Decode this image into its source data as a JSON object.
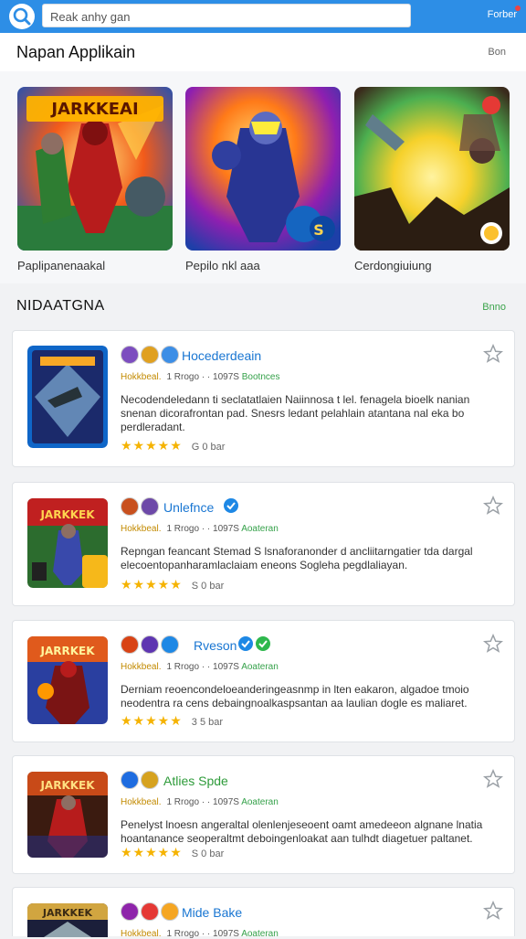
{
  "topbar": {
    "search_icon": "search-icon",
    "search_value": "Reak anhy gan",
    "right_label": "Forber"
  },
  "header": {
    "title": "Napan Applikain",
    "more": "Bon"
  },
  "featured": [
    {
      "caption": "Paplipanenaakal",
      "art_title": "JARKKEAI",
      "colors": [
        "#1a4fb8",
        "#f25b1a",
        "#2a7b3c"
      ]
    },
    {
      "caption": "Pepilo nkl aaa",
      "art_title": "",
      "colors": [
        "#5b1db0",
        "#ff7a18",
        "#1d3fa8"
      ]
    },
    {
      "caption": "Cerdongiuiung",
      "art_title": "",
      "colors": [
        "#3a2b1c",
        "#f6d12b",
        "#58c43b"
      ]
    }
  ],
  "section": {
    "title": "NIDAATGNA",
    "more": "Bnno"
  },
  "list": [
    {
      "name": "Hocederdeain",
      "publisher": "Hokkbeal.",
      "meta": "1 Rrogo · · 1097S",
      "tag": "Bootnces",
      "desc": "Necodendeledann ti seclatatlaien Naiinnosa t lel. fenagela bioelk nanian snenan dicorafrontan pad. Snesrs ledant pelahlain atantana nal eka bo perdleradant.",
      "stars": "★★★★★",
      "rating": "G 0 bar",
      "badge_colors": [
        "#7c4dbf",
        "#e0a020",
        "#3c8ee6"
      ],
      "thumb_colors": [
        "#0f66c8",
        "#a9e4ff",
        "#1b2a6b"
      ]
    },
    {
      "name": "Unlefnce",
      "publisher": "Hokkbeal.",
      "meta": "1 Rrogo · · 1097S",
      "tag": "Aoateran",
      "desc": "Repngan feancant Stemad S lsnaforanonder d ancliitarngatier tda dargal elecoentopanharamlaclaiam eneons Sogleha pegdlaliayan.",
      "stars": "★★★★★",
      "rating": "S 0 bar",
      "badge_colors": [
        "#c8501e",
        "#6d49a8",
        "#1e88e5"
      ],
      "thumb_colors": [
        "#c02020",
        "#f6b81a",
        "#2c6c2e"
      ]
    },
    {
      "name": "Rveson",
      "publisher": "Hokkbeal.",
      "meta": "1 Rrogo · · 1097S",
      "tag": "Aoateran",
      "desc": "Derniam reoencondeloeanderingeasnmp in lten eakaron, algadoe tmoio neodentra ra cens debaingnoalkaspsantan aa laulian dogle es maliaret.",
      "stars": "★★★★★",
      "rating": "3 5 bar",
      "badge_colors": [
        "#d84315",
        "#5e35b1",
        "#1e88e5",
        "#2eb84d"
      ],
      "thumb_colors": [
        "#7a1414",
        "#e05a1c",
        "#2a3fa0"
      ]
    },
    {
      "name": "Atlies Spde",
      "publisher": "Hokkbeal.",
      "meta": "1 Rrogo · · 1097S",
      "tag": "Aoateran",
      "desc": "Penelyst lnoesn angeraltal olenlenjeseoent oamt amedeeon algnane lnatia hoantanance seoperaltmt deboingenloakat aan tulhdt diagetuer paltanet.",
      "stars": "★★★★★",
      "rating": "S 0 bar",
      "badge_colors": [
        "#1e6ce0",
        "#d6a21f"
      ],
      "thumb_colors": [
        "#3b1b10",
        "#c84a18",
        "#2b2b6e"
      ]
    },
    {
      "name": "Mide Bake",
      "publisher": "Hokkbeal.",
      "meta": "1 Rrogo · · 1097S",
      "tag": "Aoateran",
      "desc": "",
      "stars": "",
      "rating": "",
      "badge_colors": [
        "#8e24aa",
        "#e53935",
        "#f5a623"
      ],
      "thumb_colors": [
        "#1b1f3a",
        "#d1a540",
        "#3b2b14"
      ]
    }
  ]
}
